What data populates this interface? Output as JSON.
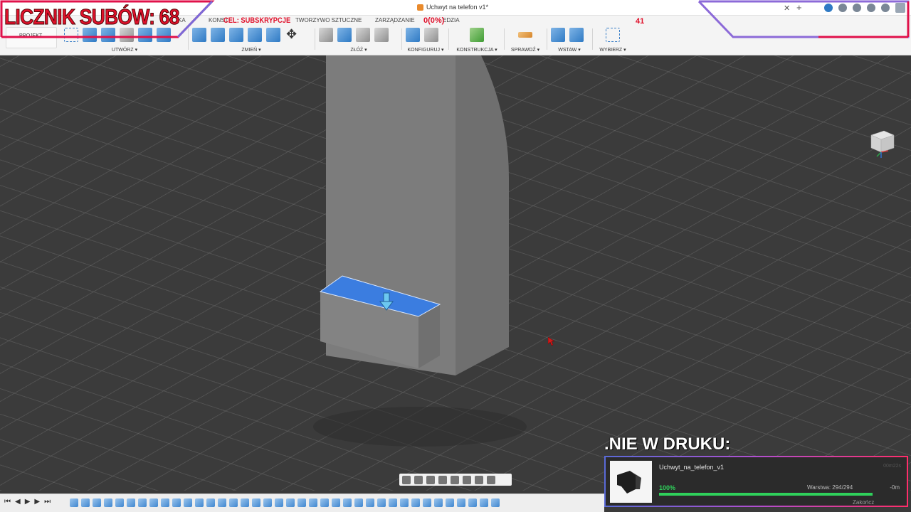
{
  "window": {
    "title": "Uchwyt na telefon v1*"
  },
  "tabs": [
    {
      "label": "KONST",
      "id": "konstrukcja"
    },
    {
      "label": "TWORZYWO SZTUCZNE",
      "id": "tworzywo"
    },
    {
      "label": "ZARZĄDZANIE",
      "id": "zarzadzanie"
    },
    {
      "label": "EDZIA",
      "id": "narzedzia"
    },
    {
      "label": "KA",
      "id": "powierzchnia"
    }
  ],
  "toolbar": {
    "projekt_label": "PROJEKT",
    "groups": [
      {
        "label": "UTWÓRZ ▾"
      },
      {
        "label": "ZMIEŃ ▾"
      },
      {
        "label": "ZŁÓŻ ▾"
      },
      {
        "label": "KONFIGURUJ ▾"
      },
      {
        "label": "KONSTRUKCJA ▾"
      },
      {
        "label": "SPRAWDŹ ▾"
      },
      {
        "label": "WSTAW ▾"
      },
      {
        "label": "WYBIERZ ▾"
      }
    ]
  },
  "overlay": {
    "sub_counter": "LICZNIK SUBÓW: 68",
    "goal_text": "CEL: SUBSKRYPCJE",
    "goal_progress": "0(0%)",
    "goal_number": "41"
  },
  "print_status": {
    "header": ".NIE W DRUKU:",
    "file_name": "Uchwyt_na_telefon_v1",
    "time_top": "00m22s",
    "percent_label": "100%",
    "percent": 1.0,
    "layer": "Warstwa: 294/294",
    "remaining": "-0m",
    "finish": "Zakończ"
  },
  "colors": {
    "overlay_red": "#e0112b",
    "selected_face": "#3b7de0",
    "progress_green": "#2fd15b"
  }
}
